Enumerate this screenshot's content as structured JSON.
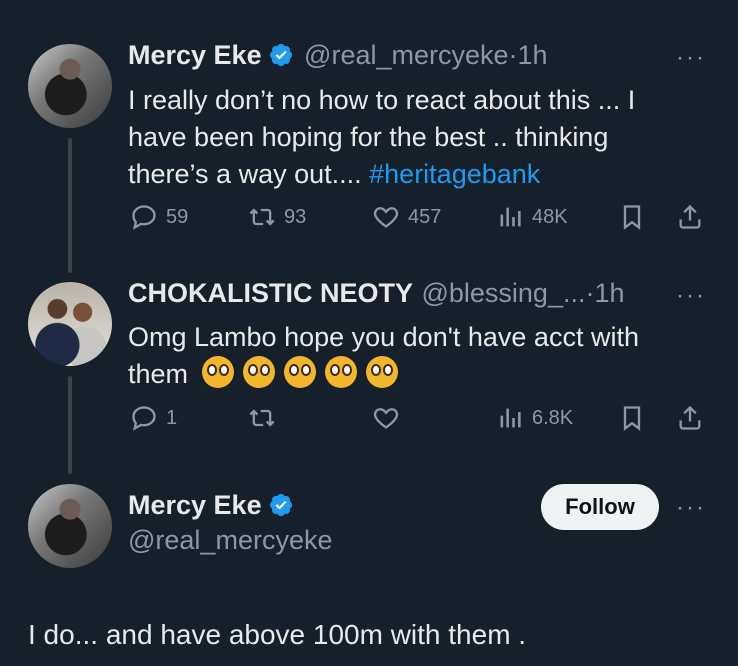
{
  "tweet1": {
    "name": "Mercy Eke",
    "handle": "@real_mercyeke",
    "separator": "·",
    "time": "1h",
    "more": "···",
    "text_part1": "I really don’t no how to react about this ... I have been hoping for the best .. thinking there’s a way out.... ",
    "hashtag": "#heritagebank",
    "stats": {
      "replies": "59",
      "retweets": "93",
      "likes": "457",
      "views": "48K"
    }
  },
  "tweet2": {
    "name": "CHOKALISTIC NEOTY",
    "handle": "@blessing_...",
    "separator": "·",
    "time": "1h",
    "more": "···",
    "text": "Omg Lambo hope you don't have acct with them",
    "emoji_count": 5,
    "stats": {
      "replies": "1",
      "views": "6.8K"
    }
  },
  "tweet3": {
    "name": "Mercy Eke",
    "handle": "@real_mercyeke",
    "follow_label": "Follow",
    "more": "···",
    "text": "I do... and have above 100m with them ."
  },
  "colors": {
    "background": "#15202b",
    "text": "#e7e9ea",
    "muted": "#8b98a5",
    "accent": "#1d9bf0"
  },
  "icons": [
    "verified-badge-icon",
    "reply-icon",
    "retweet-icon",
    "like-icon",
    "views-icon",
    "bookmark-icon",
    "share-icon",
    "more-icon"
  ]
}
